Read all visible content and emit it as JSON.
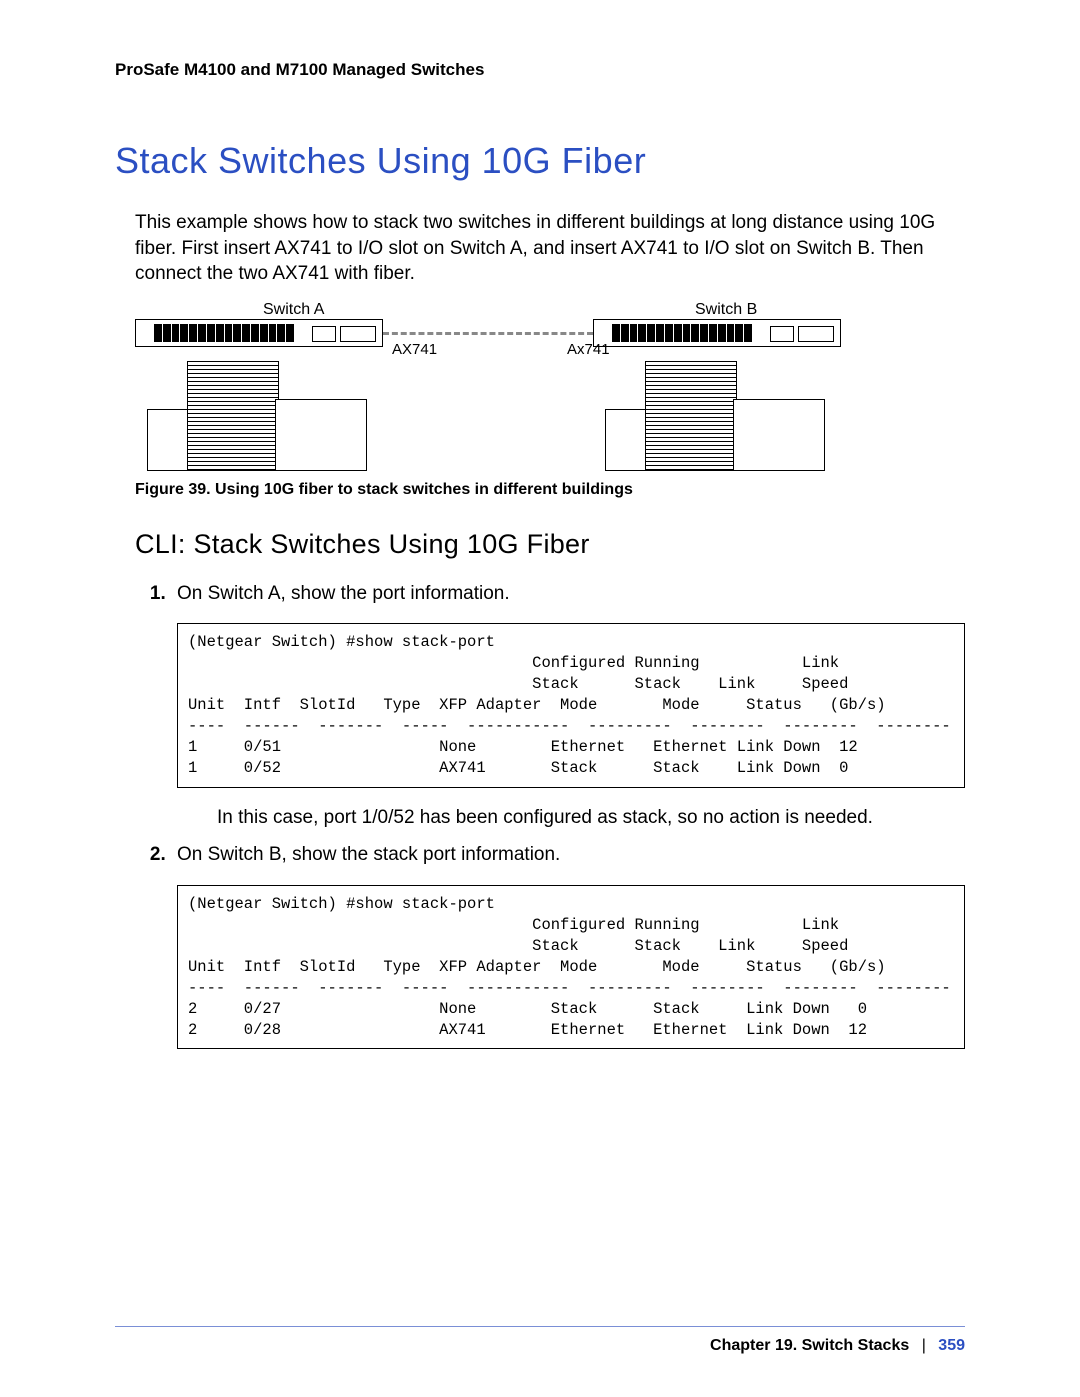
{
  "header": {
    "running_head": "ProSafe M4100 and M7100 Managed Switches"
  },
  "section": {
    "title": "Stack Switches Using 10G Fiber",
    "intro": "This example shows how to stack two switches in different buildings at long distance using 10G fiber. First insert AX741 to I/O slot on Switch A, and insert AX741 to I/O slot on Switch B. Then connect the two AX741 with fiber."
  },
  "figure": {
    "switch_a_label": "Switch A",
    "switch_b_label": "Switch B",
    "ax_left": "AX741",
    "ax_right": "Ax741",
    "caption": "Figure 39. Using 10G fiber to stack switches in different buildings"
  },
  "subsection": {
    "title": "CLI: Stack Switches Using 10G Fiber"
  },
  "steps": {
    "s1": "On Switch A, show the port information.",
    "s1_after": "In this case, port 1/0/52 has been configured as stack, so no action is needed.",
    "s2": "On Switch B, show the stack port information."
  },
  "cli1": "(Netgear Switch) #show stack-port\n                                     Configured Running           Link\n                                     Stack      Stack    Link     Speed\nUnit  Intf  SlotId   Type  XFP Adapter  Mode       Mode     Status   (Gb/s)\n----  ------  -------  -----  -----------  ---------  --------  --------  --------\n1     0/51                 None        Ethernet   Ethernet Link Down  12\n1     0/52                 AX741       Stack      Stack    Link Down  0",
  "cli2": "(Netgear Switch) #show stack-port\n                                     Configured Running           Link\n                                     Stack      Stack    Link     Speed\nUnit  Intf  SlotId   Type  XFP Adapter  Mode       Mode     Status   (Gb/s)\n----  ------  -------  -----  -----------  ---------  --------  --------  --------\n2     0/27                 None        Stack      Stack     Link Down   0\n2     0/28                 AX741       Ethernet   Ethernet  Link Down  12",
  "chart_data": {
    "type": "table",
    "tables": [
      {
        "title": "Switch A stack-port",
        "command": "(Netgear Switch) #show stack-port",
        "columns": [
          "Unit",
          "Intf",
          "SlotId",
          "Type",
          "XFP Adapter",
          "Configured Stack Mode",
          "Running Stack Mode",
          "Link Status",
          "Link Speed (Gb/s)"
        ],
        "rows": [
          [
            "1",
            "0/51",
            "",
            "",
            "None",
            "Ethernet",
            "Ethernet",
            "Link Down",
            "12"
          ],
          [
            "1",
            "0/52",
            "",
            "",
            "AX741",
            "Stack",
            "Stack",
            "Link Down",
            "0"
          ]
        ]
      },
      {
        "title": "Switch B stack-port",
        "command": "(Netgear Switch) #show stack-port",
        "columns": [
          "Unit",
          "Intf",
          "SlotId",
          "Type",
          "XFP Adapter",
          "Configured Stack Mode",
          "Running Stack Mode",
          "Link Status",
          "Link Speed (Gb/s)"
        ],
        "rows": [
          [
            "2",
            "0/27",
            "",
            "",
            "None",
            "Stack",
            "Stack",
            "Link Down",
            "0"
          ],
          [
            "2",
            "0/28",
            "",
            "",
            "AX741",
            "Ethernet",
            "Ethernet",
            "Link Down",
            "12"
          ]
        ]
      }
    ]
  },
  "footer": {
    "chapter": "Chapter 19.  Switch Stacks",
    "sep": "|",
    "page": "359"
  }
}
